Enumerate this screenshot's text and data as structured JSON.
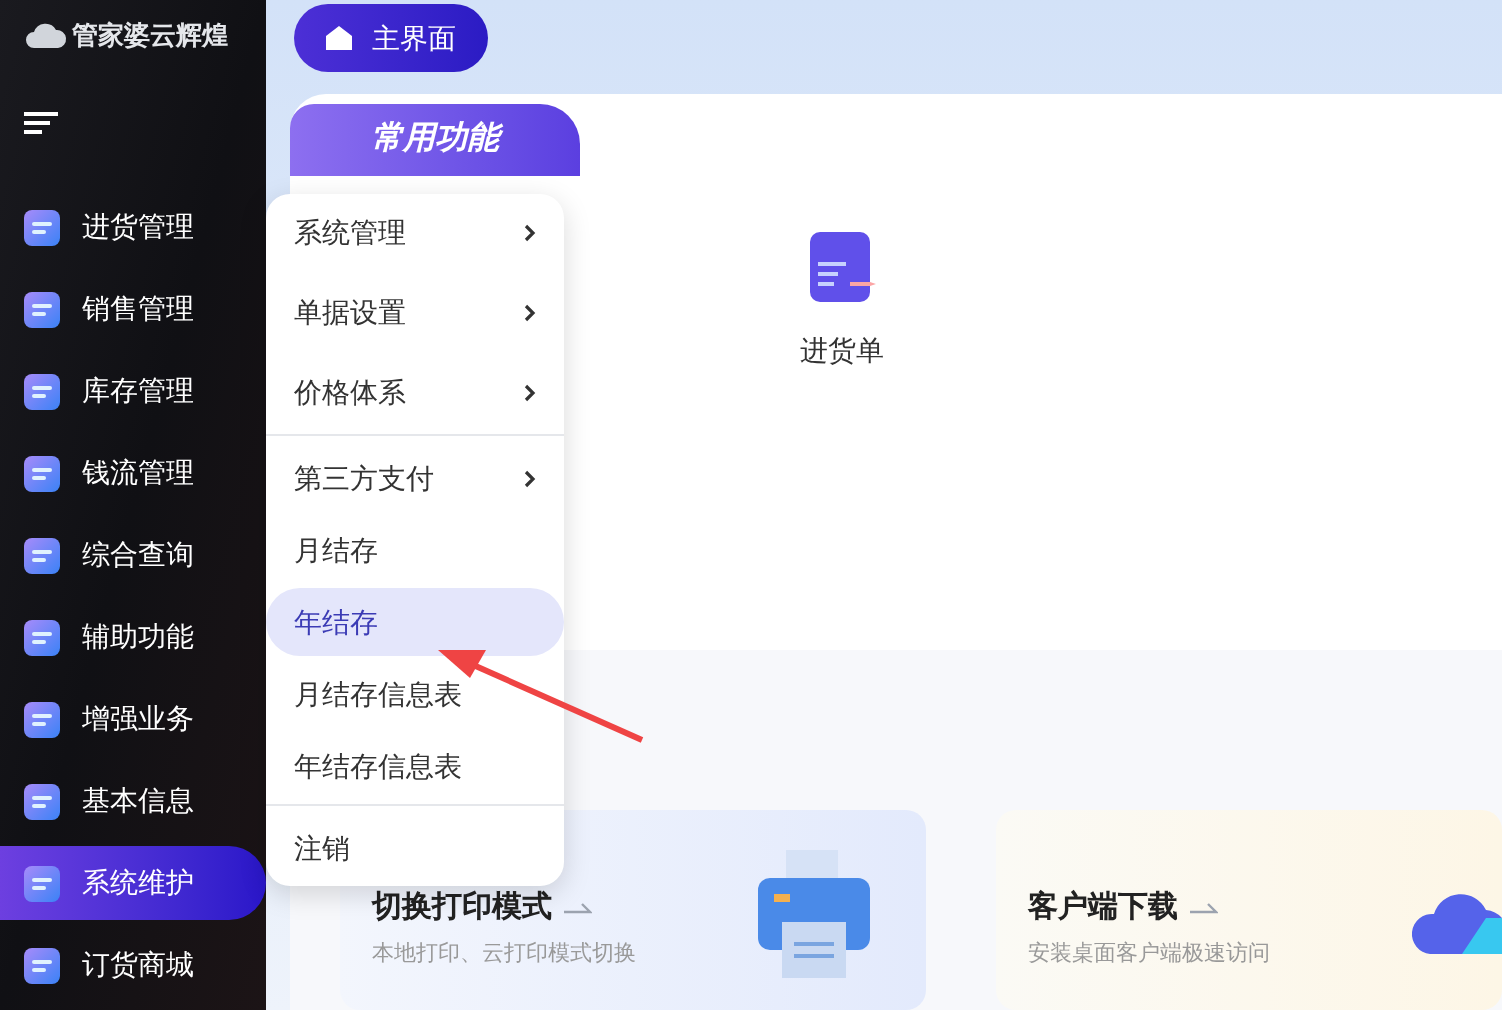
{
  "logo": {
    "text": "管家婆云辉煌"
  },
  "sidebar": {
    "items": [
      {
        "label": "进货管理",
        "selected": false
      },
      {
        "label": "销售管理",
        "selected": false
      },
      {
        "label": "库存管理",
        "selected": false
      },
      {
        "label": "钱流管理",
        "selected": false
      },
      {
        "label": "综合查询",
        "selected": false
      },
      {
        "label": "辅助功能",
        "selected": false
      },
      {
        "label": "增强业务",
        "selected": false
      },
      {
        "label": "基本信息",
        "selected": false
      },
      {
        "label": "系统维护",
        "selected": true
      },
      {
        "label": "订货商城",
        "selected": false
      }
    ]
  },
  "home_button": {
    "label": "主界面"
  },
  "section_tab": {
    "label": "常用功能"
  },
  "shortcuts": [
    {
      "label": "进货单"
    }
  ],
  "dropdown": {
    "groups": [
      [
        {
          "label": "系统管理",
          "submenu": true,
          "selected": false
        },
        {
          "label": "单据设置",
          "submenu": true,
          "selected": false
        },
        {
          "label": "价格体系",
          "submenu": true,
          "selected": false
        }
      ],
      [
        {
          "label": "第三方支付",
          "submenu": true,
          "selected": false
        },
        {
          "label": "月结存",
          "submenu": false,
          "selected": false
        },
        {
          "label": "年结存",
          "submenu": false,
          "selected": true
        },
        {
          "label": "月结存信息表",
          "submenu": false,
          "selected": false
        },
        {
          "label": "年结存信息表",
          "submenu": false,
          "selected": false
        }
      ],
      [
        {
          "label": "注销",
          "submenu": false,
          "selected": false
        }
      ]
    ]
  },
  "cards": [
    {
      "kind": "print",
      "title": "切换打印模式",
      "subtitle": "本地打印、云打印模式切换"
    },
    {
      "kind": "download",
      "title": "客户端下载",
      "subtitle": "安装桌面客户端极速访问"
    }
  ]
}
